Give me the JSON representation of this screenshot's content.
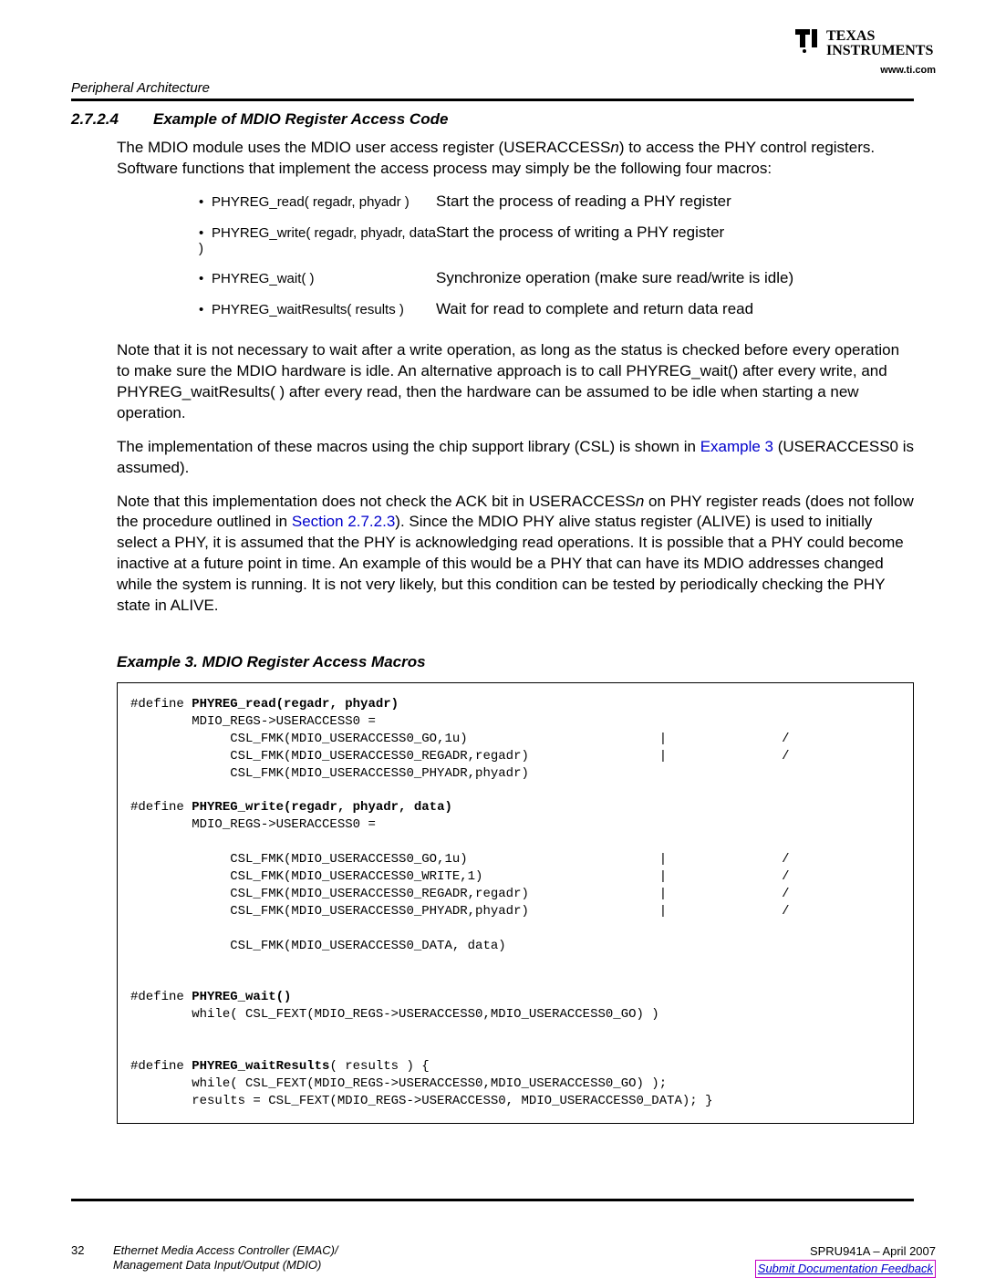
{
  "logo": {
    "brand_line1": "TEXAS",
    "brand_line2": "INSTRUMENTS",
    "url": "www.ti.com"
  },
  "running_head": "Peripheral Architecture",
  "section": {
    "number": "2.7.2.4",
    "title": "Example of MDIO Register Access Code"
  },
  "intro_paragraph_prefix": "The MDIO module uses the MDIO user access register (USERACCESS",
  "intro_paragraph_n": "n",
  "intro_paragraph_suffix": ") to access the PHY control registers. Software functions that implement the access process may simply be the following four macros:",
  "macros": [
    {
      "name": "PHYREG_read( regadr, phyadr )",
      "desc": "Start the process of reading a PHY register"
    },
    {
      "name": "PHYREG_write( regadr, phyadr, data )",
      "desc": "Start the process of writing a PHY register"
    },
    {
      "name": "PHYREG_wait( )",
      "desc": "Synchronize operation (make sure read/write is idle)"
    },
    {
      "name": "PHYREG_waitResults( results )",
      "desc": "Wait for read to complete and return data read"
    }
  ],
  "para2": "Note that it is not necessary to wait after a write operation, as long as the status is checked before every operation to make sure the MDIO hardware is idle. An alternative approach is to call PHYREG_wait() after every write, and PHYREG_waitResults( ) after every read, then the hardware can be assumed to be idle when starting a new operation.",
  "para3_prefix": "The implementation of these macros using the chip support library (CSL) is shown in ",
  "para3_link": "Example 3",
  "para3_suffix": " (USERACCESS0 is assumed).",
  "para4_prefix": "Note that this implementation does not check the ACK bit in USERACCESS",
  "para4_n": "n",
  "para4_mid": " on PHY register reads (does not follow the procedure outlined in ",
  "para4_link": "Section 2.7.2.3",
  "para4_suffix": "). Since the MDIO PHY alive status register (ALIVE) is used to initially select a PHY, it is assumed that the PHY is acknowledging read operations. It is possible that a PHY could become inactive at a future point in time. An example of this would be a PHY that can have its MDIO addresses changed while the system is running. It is not very likely, but this condition can be tested by periodically checking the PHY state in ALIVE.",
  "example_title": "Example 3. MDIO Register Access Macros",
  "code": {
    "l01a": "#define ",
    "l01b": "PHYREG_read(regadr, phyadr)",
    "l02": "        MDIO_REGS->USERACCESS0 =",
    "l03": "             CSL_FMK(MDIO_USERACCESS0_GO,1u)                         |               /",
    "l04": "             CSL_FMK(MDIO_USERACCESS0_REGADR,regadr)                 |               /",
    "l05": "             CSL_FMK(MDIO_USERACCESS0_PHYADR,phyadr)",
    "l06": "",
    "l07a": "#define ",
    "l07b": "PHYREG_write(regadr, phyadr, data)",
    "l08": "        MDIO_REGS->USERACCESS0 =",
    "l09": "",
    "l10": "             CSL_FMK(MDIO_USERACCESS0_GO,1u)                         |               /",
    "l11": "             CSL_FMK(MDIO_USERACCESS0_WRITE,1)                       |               /",
    "l12": "             CSL_FMK(MDIO_USERACCESS0_REGADR,regadr)                 |               /",
    "l13": "             CSL_FMK(MDIO_USERACCESS0_PHYADR,phyadr)                 |               /",
    "l14": "",
    "l15": "             CSL_FMK(MDIO_USERACCESS0_DATA, data)",
    "l16": "",
    "l17": "",
    "l18a": "#define ",
    "l18b": "PHYREG_wait()",
    "l19": "        while( CSL_FEXT(MDIO_REGS->USERACCESS0,MDIO_USERACCESS0_GO) )",
    "l20": "",
    "l21": "",
    "l22a": "#define ",
    "l22b": "PHYREG_waitResults",
    "l22c": "( results ) {",
    "l23": "        while( CSL_FEXT(MDIO_REGS->USERACCESS0,MDIO_USERACCESS0_GO) );",
    "l24": "        results = CSL_FEXT(MDIO_REGS->USERACCESS0, MDIO_USERACCESS0_DATA); }"
  },
  "footer": {
    "page": "32",
    "title_line1": "Ethernet Media Access Controller (EMAC)/",
    "title_line2": "Management Data Input/Output (MDIO)",
    "docid": "SPRU941A – April 2007",
    "feedback": "Submit Documentation Feedback"
  }
}
